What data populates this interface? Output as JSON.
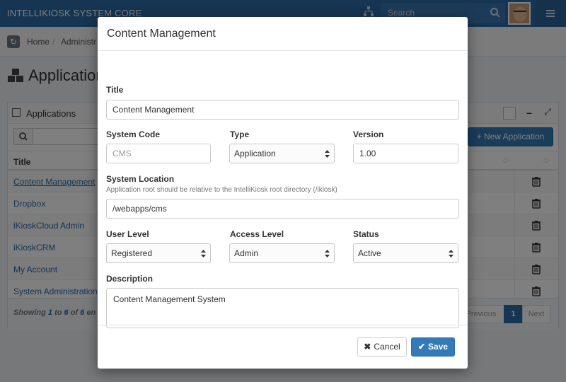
{
  "app": {
    "brand": "INTELLIKIOSK SYSTEM CORE",
    "search_placeholder": "Search"
  },
  "breadcrumb": {
    "home": "Home",
    "separator": "/",
    "current": "Administr"
  },
  "page": {
    "title": "Application"
  },
  "panel": {
    "title": "Applications",
    "new_button": "New Application",
    "column_title": "Title",
    "rows": [
      {
        "title": "Content Management"
      },
      {
        "title": "Dropbox"
      },
      {
        "title": "iKioskCloud Admin"
      },
      {
        "title": "iKioskCRM"
      },
      {
        "title": "My Account"
      },
      {
        "title": "System Administration"
      }
    ],
    "footer": {
      "showing_prefix": "Showing ",
      "from": "1",
      "to_word": " to ",
      "to": "6",
      "of_word": " of ",
      "total": "6",
      "suffix": " en"
    },
    "pagination": {
      "previous": "Previous",
      "current": "1",
      "next": "Next"
    }
  },
  "modal": {
    "title": "Content Management",
    "fields": {
      "title": {
        "label": "Title",
        "value": "Content Management"
      },
      "system_code": {
        "label": "System Code",
        "placeholder": "CMS"
      },
      "type": {
        "label": "Type",
        "value": "Application"
      },
      "version": {
        "label": "Version",
        "value": "1.00"
      },
      "system_location": {
        "label": "System Location",
        "help": "Application root should be relative to the IntelliKiosk root directory (/ikiosk)",
        "value": "/webapps/cms"
      },
      "user_level": {
        "label": "User Level",
        "value": "Registered"
      },
      "access_level": {
        "label": "Access Level",
        "value": "Admin"
      },
      "status": {
        "label": "Status",
        "value": "Active"
      },
      "description": {
        "label": "Description",
        "value": "Content Management System"
      }
    },
    "buttons": {
      "cancel": "Cancel",
      "save": "Save"
    }
  },
  "colors": {
    "primary": "#337ab7",
    "topbar": "#2c6aa5",
    "link": "#2a6aa8"
  }
}
